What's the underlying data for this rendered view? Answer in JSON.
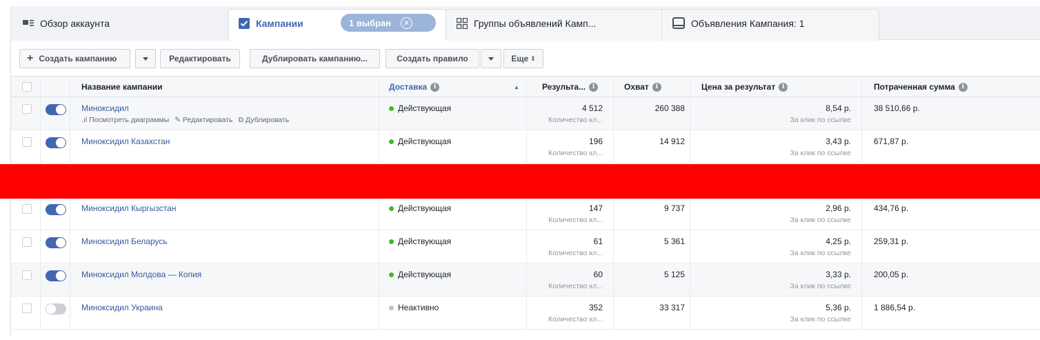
{
  "tabs": {
    "overview": "Обзор аккаунта",
    "campaigns": "Кампании",
    "selected_chip": "1 выбран",
    "adsets": "Группы объявлений Камп...",
    "ads": "Объявления Кампания: 1"
  },
  "toolbar": {
    "create": "Создать кампанию",
    "edit": "Редактировать",
    "duplicate": "Дублировать кампанию...",
    "create_rule": "Создать правило",
    "more": "Еще"
  },
  "columns": {
    "name": "Название кампании",
    "delivery": "Доставка",
    "results": "Результа...",
    "reach": "Охват",
    "cost": "Цена за результат",
    "spent": "Потраченная сумма"
  },
  "row_actions": {
    "charts": "Посмотреть диаграммы",
    "edit": "Редактировать",
    "duplicate": "Дублировать"
  },
  "rows": [
    {
      "name": "Миноксидил",
      "status": "Действующая",
      "results": "4 512",
      "results_sub": "Количество кл...",
      "reach": "260 388",
      "cost": "8,54 р.",
      "cost_sub": "За клик по ссылке",
      "spent": "38 510,66 р.",
      "on": true
    },
    {
      "name": "Миноксидил Казахстан",
      "status": "Действующая",
      "results": "196",
      "results_sub": "Количество кл...",
      "reach": "14 912",
      "cost": "3,43 р.",
      "cost_sub": "За клик по ссылке",
      "spent": "671,87 р.",
      "on": true
    },
    {
      "name": "Миноксидил Кыргызстан",
      "status": "Действующая",
      "results": "147",
      "results_sub": "Количество кл...",
      "reach": "9 737",
      "cost": "2,96 р.",
      "cost_sub": "За клик по ссылке",
      "spent": "434,76 р.",
      "on": true
    },
    {
      "name": "Миноксидил Беларусь",
      "status": "Действующая",
      "results": "61",
      "results_sub": "Количество кл...",
      "reach": "5 361",
      "cost": "4,25 р.",
      "cost_sub": "За клик по ссылке",
      "spent": "259,31 р.",
      "on": true
    },
    {
      "name": "Миноксидил Молдова — Копия",
      "status": "Действующая",
      "results": "60",
      "results_sub": "Количество кл...",
      "reach": "5 125",
      "cost": "3,33 р.",
      "cost_sub": "За клик по ссылке",
      "spent": "200,05 р.",
      "on": true
    },
    {
      "name": "Миноксидил Украина",
      "status": "Неактивно",
      "results": "352",
      "results_sub": "Количество кл...",
      "reach": "33 317",
      "cost": "5,36 р.",
      "cost_sub": "За клик по ссылке",
      "spent": "1 886,54 р.",
      "on": false
    }
  ],
  "colors": {
    "accent": "#4267b2",
    "link": "#365899",
    "active_dot": "#42b72a",
    "redaction": "#ff0000"
  }
}
